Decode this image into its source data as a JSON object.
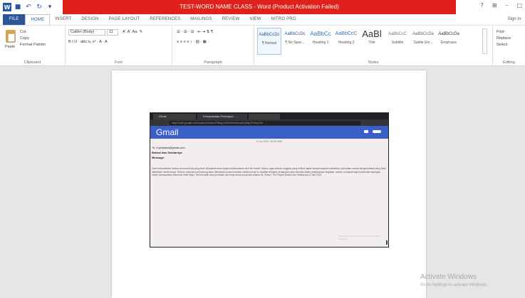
{
  "window": {
    "title": "TEST-WORD NAME CLASS - Word (Product Activation Failed)",
    "controls": [
      "?",
      "⊞",
      "–",
      "□"
    ]
  },
  "qat": {
    "icons": [
      "word-logo-icon",
      "save-icon",
      "undo-icon",
      "redo-icon",
      "customize-icon"
    ]
  },
  "tabs": {
    "items": [
      "FILE",
      "HOME",
      "INSERT",
      "DESIGN",
      "PAGE LAYOUT",
      "REFERENCES",
      "MAILINGS",
      "REVIEW",
      "VIEW",
      "NITRO PRO"
    ],
    "active": "HOME",
    "signin": "Sign in"
  },
  "ribbon": {
    "clipboard": {
      "label": "Clipboard",
      "paste": "Paste",
      "cut": "Cut",
      "copy": "Copy",
      "format_painter": "Format Painter"
    },
    "font": {
      "label": "Font",
      "name": "Calibri (Body)",
      "size": "11",
      "buttons": "B  I  U  ·  abc  x₂  x²  ·  A  ·  A"
    },
    "paragraph": {
      "label": "Paragraph",
      "row1": "☰ · ☰ · ☰ ·  ⇤ ⇥  ⇅  ¶",
      "row2": "≡  ≡  ≡  ≡   ↕ ·  ▧ ·  ▦ ·"
    },
    "styles": {
      "label": "Styles",
      "items": [
        {
          "preview": "AaBbCcDc",
          "name": "¶ Normal"
        },
        {
          "preview": "AaBbCcDc",
          "name": "¶ No Spac..."
        },
        {
          "preview": "AaBbCc",
          "name": "Heading 1"
        },
        {
          "preview": "AaBbCcC",
          "name": "Heading 2"
        },
        {
          "preview": "AaBl",
          "name": "Title"
        },
        {
          "preview": "AaBbCcC",
          "name": "Subtitle"
        },
        {
          "preview": "AaBbCcDa",
          "name": "Subtle Em..."
        },
        {
          "preview": "AaBbCcDa",
          "name": "Emphasis"
        }
      ]
    },
    "editing": {
      "label": "Editing",
      "find": "Find ·",
      "replace": "Replace",
      "select": "Select ·"
    }
  },
  "embedded_browser": {
    "tabs": [
      "Gmail",
      "Kesepakatan-Pekerjaan - ...",
      ""
    ],
    "url": "https://mail.google.com/mail/u/0/#inbox/FMfcgzGxSbcRzmJvsqHnWklgTPzNqLMd",
    "app_logo": "Gmail",
    "meta": "8 Jun 2022, 15.00 WIB",
    "to": "To: fr.pratama@gmail.com",
    "subject": "Bekasi dan Sekitarnya",
    "label": "Message:",
    "body": "Kami informasikan bahwa rencana kerja yang telah disepakati akan segera dilaksanakan oleh tim terkait. Mohon agar seluruh anggota yang terlibat dapat mempersiapkan kebutuhan pekerjaan sesuai dengan jadwal yang telah ditentukan sebelumnya. Seluruh dokumen pendukung akan dikirimkan secara terpisah melalui email ini. Apabila terdapat pertanyaan atau kendala dalam pelaksanaan kegiatan, silakan menghubungi koordinator lapangan untuk mendapatkan informasi lebih lanjut. Terima kasih atas perhatian dan kerja sama yang baik selama ini. Salam, Tim Proyek Bekasi dan Sekitarnya, 8 Juni 2022.",
    "faint": "Activate Windows\nGo to Settings to activate Windows."
  },
  "watermark": {
    "title": "Activate Windows",
    "subtitle": "Go to Settings to activate Windows."
  }
}
